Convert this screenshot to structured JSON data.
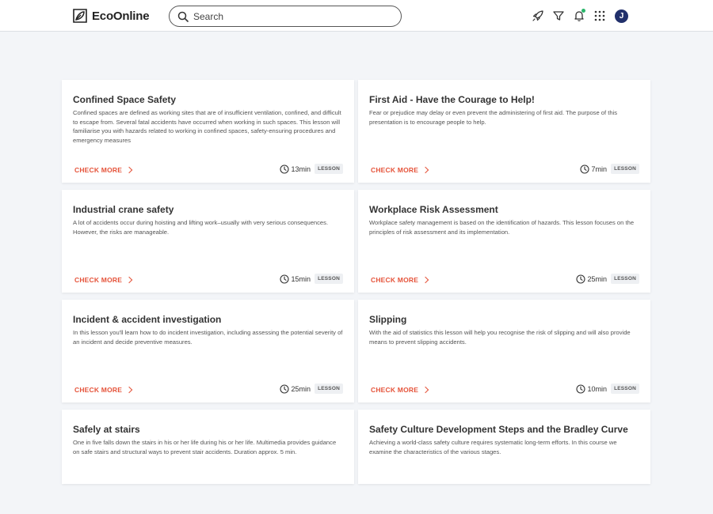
{
  "app": {
    "name": "EcoOnline"
  },
  "search": {
    "placeholder": "Search"
  },
  "header_icons": [
    "rocket-icon",
    "filter-icon",
    "bell-icon",
    "apps-grid-icon"
  ],
  "user": {
    "initial": "J"
  },
  "colors": {
    "accent": "#e5533a",
    "avatar": "#21306b",
    "notification": "#2ab56b"
  },
  "cards": [
    {
      "title": "Confined Space Safety",
      "description": "Confined spaces are defined as working sites that are of insufficient ventilation, confined, and difficult to escape from. Several fatal accidents have occurred when working in such spaces. This lesson will familiarise you with hazards related to working in confined spaces, safety-ensuring procedures and emergency measures",
      "cta": "CHECK MORE",
      "duration": "13min",
      "type": "LESSON"
    },
    {
      "title": "First Aid - Have the Courage to Help!",
      "description": "Fear or prejudice may delay or even prevent the administering of first aid. The purpose of this presentation is to encourage people to help.",
      "cta": "CHECK MORE",
      "duration": "7min",
      "type": "LESSON"
    },
    {
      "title": "Industrial crane safety",
      "description": "A lot of accidents occur during hoisting and lifting work–usually with very serious consequences. However, the risks are manageable.",
      "cta": "CHECK MORE",
      "duration": "15min",
      "type": "LESSON"
    },
    {
      "title": "Workplace Risk Assessment",
      "description": "Workplace safety management is based on the identification of hazards. This lesson focuses on the principles of risk assessment and its implementation.",
      "cta": "CHECK MORE",
      "duration": "25min",
      "type": "LESSON"
    },
    {
      "title": "Incident & accident investigation",
      "description": "In this lesson you'll learn how to do incident investigation, including assessing the potential severity of an incident and decide preventive measures.",
      "cta": "CHECK MORE",
      "duration": "25min",
      "type": "LESSON"
    },
    {
      "title": "Slipping",
      "description": "With the aid of statistics this lesson will help you recognise the risk of slipping and will also provide means to prevent slipping accidents.",
      "cta": "CHECK MORE",
      "duration": "10min",
      "type": "LESSON"
    },
    {
      "title": "Safely at stairs",
      "description": "One in five falls down the stairs in his or her life during his or her life. Multimedia provides guidance on safe stairs and structural ways to prevent stair accidents. Duration approx. 5 min."
    },
    {
      "title": "Safety Culture Development Steps and the Bradley Curve",
      "description": "Achieving a world-class safety culture requires systematic long-term efforts. In this course we examine the characteristics of the various stages."
    }
  ]
}
